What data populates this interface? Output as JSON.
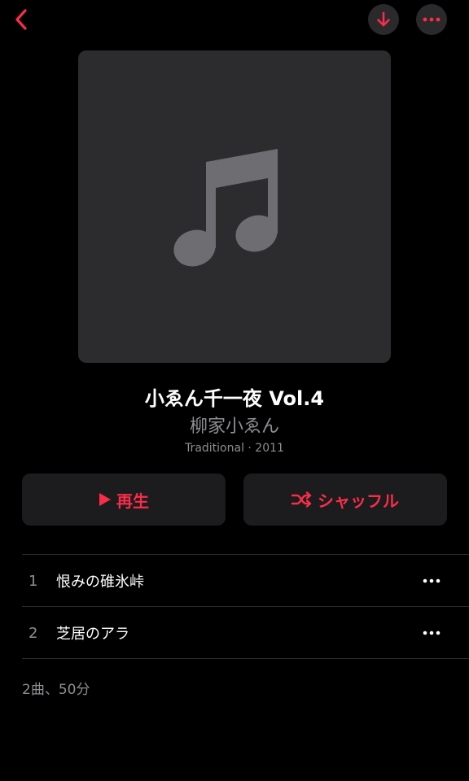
{
  "header": {
    "back_icon": "chevron-left-icon",
    "download_icon": "arrow-down-icon",
    "more_icon": "ellipsis-icon",
    "accent_color": "#fa2d48"
  },
  "album": {
    "artwork_icon": "music-note-icon",
    "title": "小ゑん千一夜 Vol.4",
    "artist": "柳家小ゑん",
    "meta": "Traditional · 2011"
  },
  "actions": {
    "play_label": "再生",
    "play_icon": "play-icon",
    "shuffle_label": "シャッフル",
    "shuffle_icon": "shuffle-icon"
  },
  "tracks": [
    {
      "number": "1",
      "title": "恨みの碓氷峠"
    },
    {
      "number": "2",
      "title": "芝居のアラ"
    }
  ],
  "summary": "2曲、50分"
}
